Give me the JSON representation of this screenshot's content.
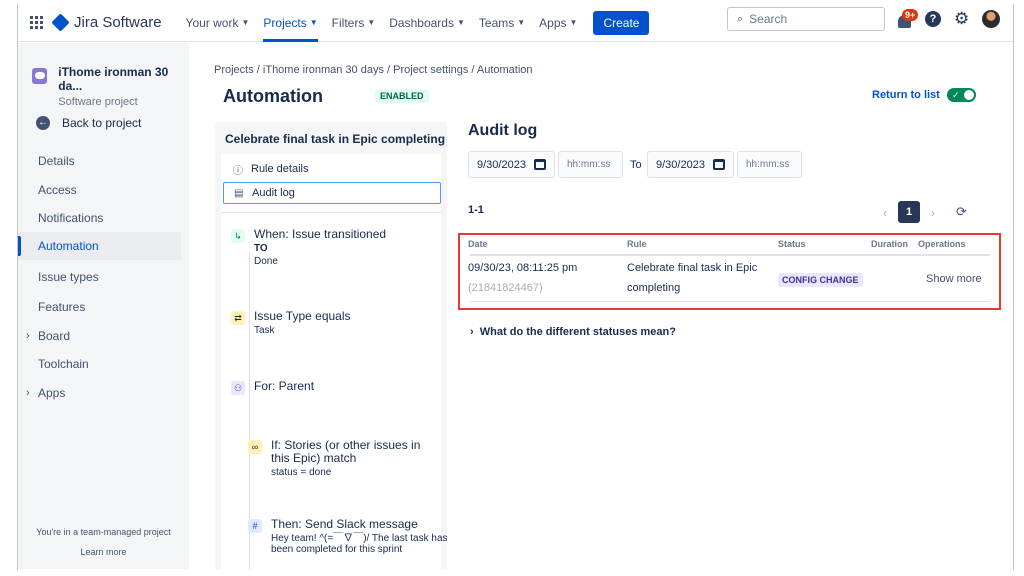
{
  "nav": {
    "app_name": "Jira Software",
    "items": [
      {
        "label": "Your work"
      },
      {
        "label": "Projects"
      },
      {
        "label": "Filters"
      },
      {
        "label": "Dashboards"
      },
      {
        "label": "Teams"
      },
      {
        "label": "Apps"
      }
    ],
    "create_label": "Create",
    "search_placeholder": "Search",
    "notification_badge": "9+"
  },
  "sidebar": {
    "project_name": "iThome ironman 30 da...",
    "project_type": "Software project",
    "back_label": "Back to project",
    "items": [
      {
        "label": "Details"
      },
      {
        "label": "Access"
      },
      {
        "label": "Notifications"
      },
      {
        "label": "Automation"
      },
      {
        "label": "Issue types"
      },
      {
        "label": "Features"
      },
      {
        "label": "Board"
      },
      {
        "label": "Toolchain"
      },
      {
        "label": "Apps"
      }
    ],
    "team_note": "You're in a team-managed project",
    "learn_more": "Learn more"
  },
  "header": {
    "breadcrumb": "Projects  /  iThome ironman 30 days  /  Project settings  /  Automation",
    "title": "Automation",
    "enabled_badge": "ENABLED",
    "return_label": "Return to list"
  },
  "rule": {
    "title": "Celebrate final task in Epic completing",
    "tabs": [
      {
        "label": "Rule details"
      },
      {
        "label": "Audit log"
      }
    ],
    "components": [
      {
        "title": "When: Issue transitioned",
        "sub1": "TO",
        "sub2": "Done"
      },
      {
        "title": "Issue Type equals",
        "sub1": "Task"
      },
      {
        "title": "For: Parent"
      },
      {
        "title": "If: Stories (or other issues in this Epic) match",
        "sub1": "status = done"
      },
      {
        "title": "Then: Send Slack message",
        "sub1": "Hey team! ^(=￣∇￣)/ The last task has been completed for this sprint"
      }
    ]
  },
  "audit": {
    "title": "Audit log",
    "from_date": "9/30/2023",
    "from_time_placeholder": "hh:mm:ss",
    "to_label": "To",
    "to_date": "9/30/2023",
    "to_time_placeholder": "hh:mm:ss",
    "result_count": "1-1",
    "current_page": "1",
    "columns": [
      "Date",
      "Rule",
      "Status",
      "Duration",
      "Operations"
    ],
    "rows": [
      {
        "date": "09/30/23, 08:11:25 pm",
        "id": "(21841824467)",
        "rule_line1": "Celebrate final task in Epic",
        "rule_line2": "completing",
        "status": "CONFIG CHANGE",
        "operation": "Show more"
      }
    ],
    "statuses_help": "What do the different statuses mean?"
  },
  "colors": {
    "brand": "#0052cc",
    "highlight_box": "#e53935",
    "toggle_on": "#00875a"
  }
}
